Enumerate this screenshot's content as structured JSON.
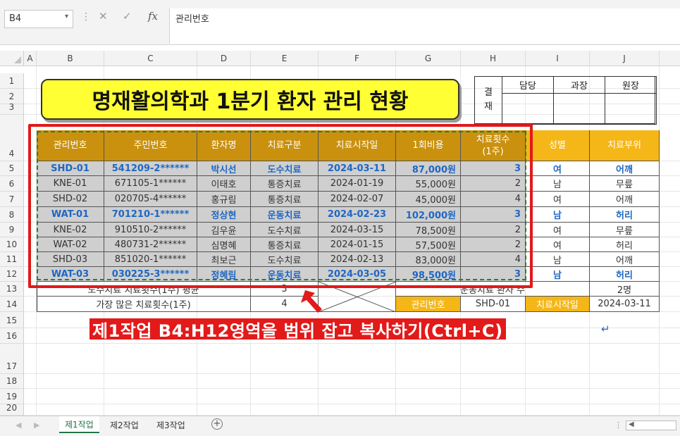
{
  "formula_bar": {
    "name_box": "B4",
    "cancel_icon": "✕",
    "enter_icon": "✓",
    "fx_label": "fx",
    "value": "관리번호"
  },
  "columns": [
    "A",
    "B",
    "C",
    "D",
    "E",
    "F",
    "G",
    "H",
    "I",
    "J"
  ],
  "rows": [
    "1",
    "2",
    "3",
    "4",
    "5",
    "6",
    "7",
    "8",
    "9",
    "10",
    "11",
    "12",
    "13",
    "14",
    "15",
    "16",
    "17",
    "18",
    "19",
    "20"
  ],
  "title": "명재활의학과 1분기 환자 관리 현황",
  "approval": {
    "side_label_1": "결",
    "side_label_2": "재",
    "headers": [
      "담당",
      "과장",
      "원장"
    ]
  },
  "table": {
    "headers": [
      "관리번호",
      "주민번호",
      "환자명",
      "치료구분",
      "치료시작일",
      "1회비용",
      "치료횟수\n(1주)",
      "성별",
      "치료부위"
    ],
    "rows": [
      {
        "cells": [
          "SHD-01",
          "541209-2******",
          "박시선",
          "도수치료",
          "2024-03-11",
          "87,000원",
          "3",
          "여",
          "어깨"
        ],
        "highlight": true
      },
      {
        "cells": [
          "KNE-01",
          "671105-1******",
          "이태호",
          "통증치료",
          "2024-01-19",
          "55,000원",
          "2",
          "남",
          "무릎"
        ],
        "highlight": false
      },
      {
        "cells": [
          "SHD-02",
          "020705-4******",
          "홍규림",
          "통증치료",
          "2024-02-07",
          "45,000원",
          "4",
          "여",
          "어깨"
        ],
        "highlight": false
      },
      {
        "cells": [
          "WAT-01",
          "701210-1******",
          "정상현",
          "운동치료",
          "2024-02-23",
          "102,000원",
          "3",
          "남",
          "허리"
        ],
        "highlight": true
      },
      {
        "cells": [
          "KNE-02",
          "910510-2******",
          "김우윤",
          "도수치료",
          "2024-03-15",
          "78,500원",
          "2",
          "여",
          "무릎"
        ],
        "highlight": false
      },
      {
        "cells": [
          "WAT-02",
          "480731-2******",
          "심명혜",
          "통증치료",
          "2024-01-15",
          "57,500원",
          "2",
          "여",
          "허리"
        ],
        "highlight": false
      },
      {
        "cells": [
          "SHD-03",
          "851020-1******",
          "최보근",
          "도수치료",
          "2024-02-13",
          "83,000원",
          "4",
          "남",
          "어깨"
        ],
        "highlight": false
      },
      {
        "cells": [
          "WAT-03",
          "030225-3******",
          "정혜림",
          "운동치료",
          "2024-03-05",
          "98,500원",
          "3",
          "남",
          "허리"
        ],
        "highlight": true
      }
    ]
  },
  "summary": {
    "row13_label": "도수치료 치료횟수(1주) 평균",
    "row13_value": "3",
    "row13_right_label": "운동치료 환자 수",
    "row13_right_value": "2명",
    "row14_label": "가장 많은 치료횟수(1주)",
    "row14_value": "4",
    "row14_key_label": "관리번호",
    "row14_key_value": "SHD-01",
    "row14_date_label": "치료시작일",
    "row14_date_value": "2024-03-11"
  },
  "instruction": "제1작업 B4:H12영역을 범위 잡고  복사하기(Ctrl+C)",
  "return_glyph": "↵",
  "sheet_tabs": [
    "제1작업",
    "제2작업",
    "제3작업"
  ],
  "add_sheet": "+",
  "colors": {
    "header_dark": "#c9910e",
    "header_light": "#f5b617",
    "title_bg": "#ffff33",
    "highlight_text": "#1f67c3",
    "annotation_red": "#e21a1a"
  }
}
